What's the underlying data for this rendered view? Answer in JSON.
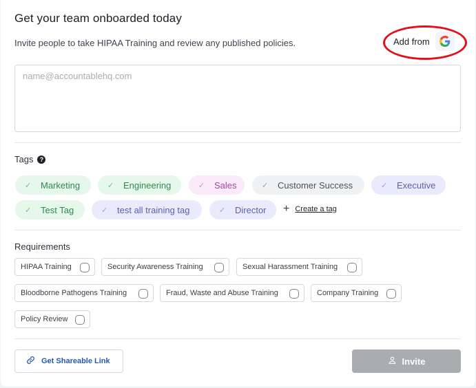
{
  "header": {
    "title": "Get your team onboarded today",
    "subtitle": "Invite people to take HIPAA Training and review any published policies.",
    "add_from_label": "Add from",
    "add_from_icon": "google-icon"
  },
  "email_input": {
    "placeholder": "name@accountablehq.com",
    "value": ""
  },
  "tags": {
    "label": "Tags",
    "items": [
      {
        "label": "Marketing",
        "checked": true,
        "color": "#e6f7ec"
      },
      {
        "label": "Engineering",
        "checked": true,
        "color": "#e6f7ec"
      },
      {
        "label": "Sales",
        "checked": true,
        "color": "#fbeafa"
      },
      {
        "label": "Customer Success",
        "checked": true,
        "color": "#f0f1f3"
      },
      {
        "label": "Executive",
        "checked": true,
        "color": "#e9eafb"
      },
      {
        "label": "Test Tag",
        "checked": true,
        "color": "#e6f7ec"
      },
      {
        "label": "test all training tag",
        "checked": true,
        "color": "#e9eafb"
      },
      {
        "label": "Director",
        "checked": true,
        "color": "#e9eafb"
      }
    ],
    "create_label": "Create a tag"
  },
  "requirements": {
    "label": "Requirements",
    "items": [
      {
        "label": "HIPAA Training",
        "checked": false
      },
      {
        "label": "Security Awareness Training",
        "checked": false
      },
      {
        "label": "Sexual Harassment Training",
        "checked": false
      },
      {
        "label": "Bloodborne Pathogens Training",
        "checked": false
      },
      {
        "label": "Fraud, Waste and Abuse Training",
        "checked": false
      },
      {
        "label": "Company Training",
        "checked": false
      },
      {
        "label": "Policy Review",
        "checked": false
      }
    ]
  },
  "footer": {
    "share_label": "Get Shareable Link",
    "share_icon": "link-icon",
    "invite_label": "Invite",
    "invite_icon": "user-icon",
    "invite_disabled_color": "#a9acb1"
  },
  "colors": {
    "accent_link": "#2559b8",
    "highlight_ring": "#e3101b"
  }
}
